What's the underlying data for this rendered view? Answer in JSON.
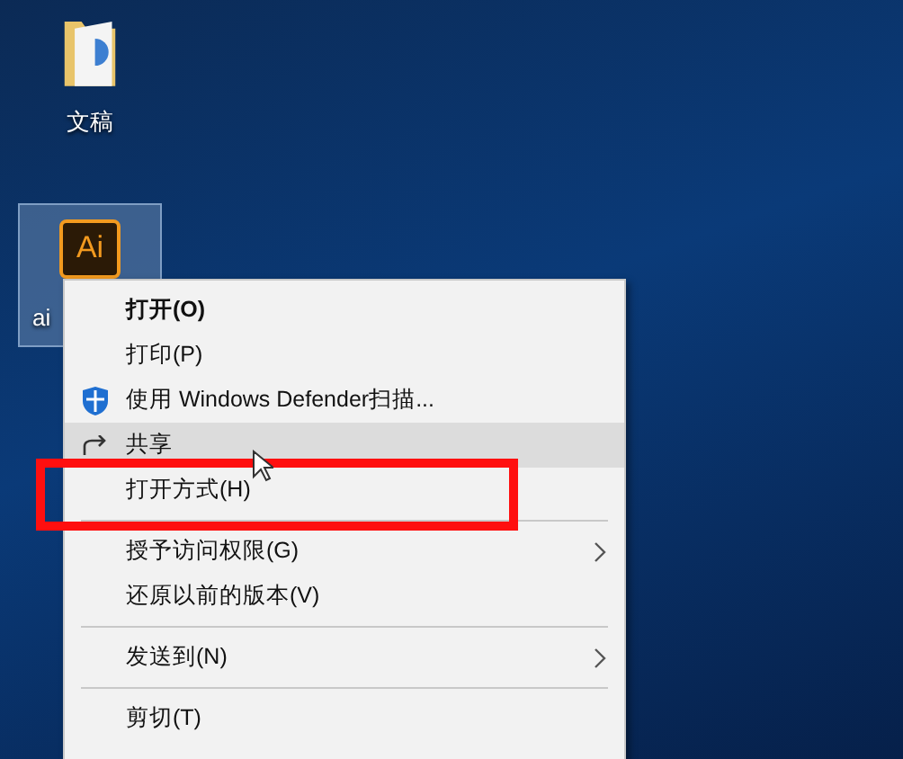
{
  "desktop_icons": [
    {
      "kind": "folder",
      "label": "文稿",
      "selected": false
    },
    {
      "kind": "ai",
      "icon_text": "Ai",
      "label": "ai",
      "selected": true
    }
  ],
  "context_menu": {
    "items": [
      {
        "kind": "item",
        "label": "打开(O)",
        "bold": true,
        "selected": false
      },
      {
        "kind": "item",
        "label": "打印(P)",
        "bold": false,
        "selected": false
      },
      {
        "kind": "scan",
        "label": "使用 Windows Defender扫描...",
        "bold": false,
        "selected": false
      },
      {
        "kind": "share",
        "label": "共享",
        "bold": false,
        "selected": true
      },
      {
        "kind": "item",
        "label": "打开方式(H)",
        "bold": false,
        "selected": false,
        "annotated": true
      },
      {
        "kind": "separator"
      },
      {
        "kind": "item",
        "label": "授予访问权限(G)",
        "bold": false,
        "selected": false,
        "submenu": true
      },
      {
        "kind": "item",
        "label": "还原以前的版本(V)",
        "bold": false,
        "selected": false
      },
      {
        "kind": "separator"
      },
      {
        "kind": "item",
        "label": "发送到(N)",
        "bold": false,
        "selected": false,
        "submenu": true
      },
      {
        "kind": "separator"
      },
      {
        "kind": "item",
        "label": "剪切(T)",
        "bold": false,
        "selected": false
      }
    ]
  }
}
